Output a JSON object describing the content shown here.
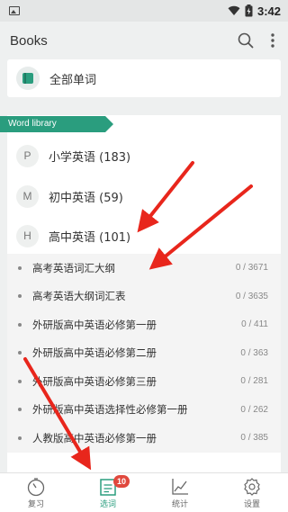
{
  "status_bar": {
    "time": "3:42",
    "icons": [
      "gallery-icon",
      "wifi-icon",
      "battery-charging-icon"
    ]
  },
  "app_bar": {
    "title": "Books",
    "actions": [
      "search-icon",
      "more-vertical-icon"
    ]
  },
  "all_words": {
    "icon": "book-icon",
    "label": "全部单词"
  },
  "library": {
    "tag": "Word library",
    "categories": [
      {
        "letter": "P",
        "label": "小学英语 (183)"
      },
      {
        "letter": "M",
        "label": "初中英语 (59)"
      },
      {
        "letter": "H",
        "label": "高中英语 (101)"
      }
    ],
    "books": [
      {
        "title": "高考英语词汇大纲",
        "count": "0 / 3671"
      },
      {
        "title": "高考英语大纲词汇表",
        "count": "0 / 3635"
      },
      {
        "title": "外研版高中英语必修第一册",
        "count": "0 / 411"
      },
      {
        "title": "外研版高中英语必修第二册",
        "count": "0 / 363"
      },
      {
        "title": "外研版高中英语必修第三册",
        "count": "0 / 281"
      },
      {
        "title": "外研版高中英语选择性必修第一册",
        "count": "0 / 262"
      },
      {
        "title": "人教版高中英语必修第一册",
        "count": "0 / 385"
      }
    ]
  },
  "bottom_nav": {
    "items": [
      {
        "label": "复习",
        "icon": "stopwatch-icon",
        "active": false
      },
      {
        "label": "选词",
        "icon": "word-list-icon",
        "active": true,
        "badge": "10"
      },
      {
        "label": "统计",
        "icon": "line-chart-icon",
        "active": false
      },
      {
        "label": "设置",
        "icon": "gear-icon",
        "active": false
      }
    ]
  },
  "colors": {
    "accent": "#2a9d7e",
    "badge": "#e0483d",
    "annotation_arrow": "#e8261c"
  }
}
